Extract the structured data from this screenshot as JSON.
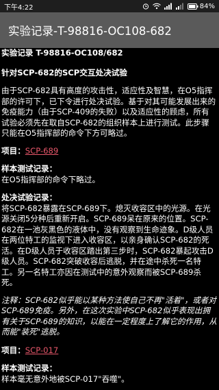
{
  "status_bar": {
    "time": "下午4:22",
    "battery": "84%"
  },
  "app_bar": {
    "title": "实验记录-T-98816-OC108-682"
  },
  "doc": {
    "heading": "实验记录 T-98816-OC108/682",
    "subheading": "针对SCP-682的SCP交互处决试验",
    "intro": "由于SCP-682具有高度的攻击性，适应性及智慧，在O5指挥部的许可下，已下令进行处决试验。基于对其可能发展出来的免疫能力（由于SCP-409的失败）以及适应性的顾虑，所有试验必须先在取自SCP-682的组织样本上进行测试。此步骤只能在O5指挥部的命令下方可略过。",
    "item1_label": "项目：",
    "item1_link": "SCP-689",
    "sample_label": "样本测试记录：",
    "sample_text": "在O5指挥部的命令下略过。",
    "exec_label": "处决试验记录：",
    "exec_text": "将SCP-682暴露在SCP-689下。熄灭收容区中的光源。在光源关闭5分种后重新开启。SCP-689呆在原来的位置。SCP-682在一池灰黑色的液体中，没有观察到生命迹象。D级人员在两位特工的监视下进入收容区，以亲身确认SCP-682的死活。在D级人员于收容区踏出第三步时，SCP-682暴起攻击D级人员。SCP-682突破收容后逃脱，并在途中杀死一名特工。另一名特工亦因在测试中的意外观察而被SCP-689杀死。",
    "note": "注释：SCP-682似乎能以某种方法使自己不再\"活着\"，或者对SCP-689免疫。另外，在这次实验中SCP-682似乎表现出拥有关于SCP-689的知识，以能在一定程度上了解它的作用，从而能\"装死\"逃脱。",
    "item2_label": "项目：",
    "item2_link": "SCP-017",
    "sample2_label": "样本测试记录：",
    "sample2_text": "样本毫无意外地被SCP-017\"吞噬\"。"
  }
}
